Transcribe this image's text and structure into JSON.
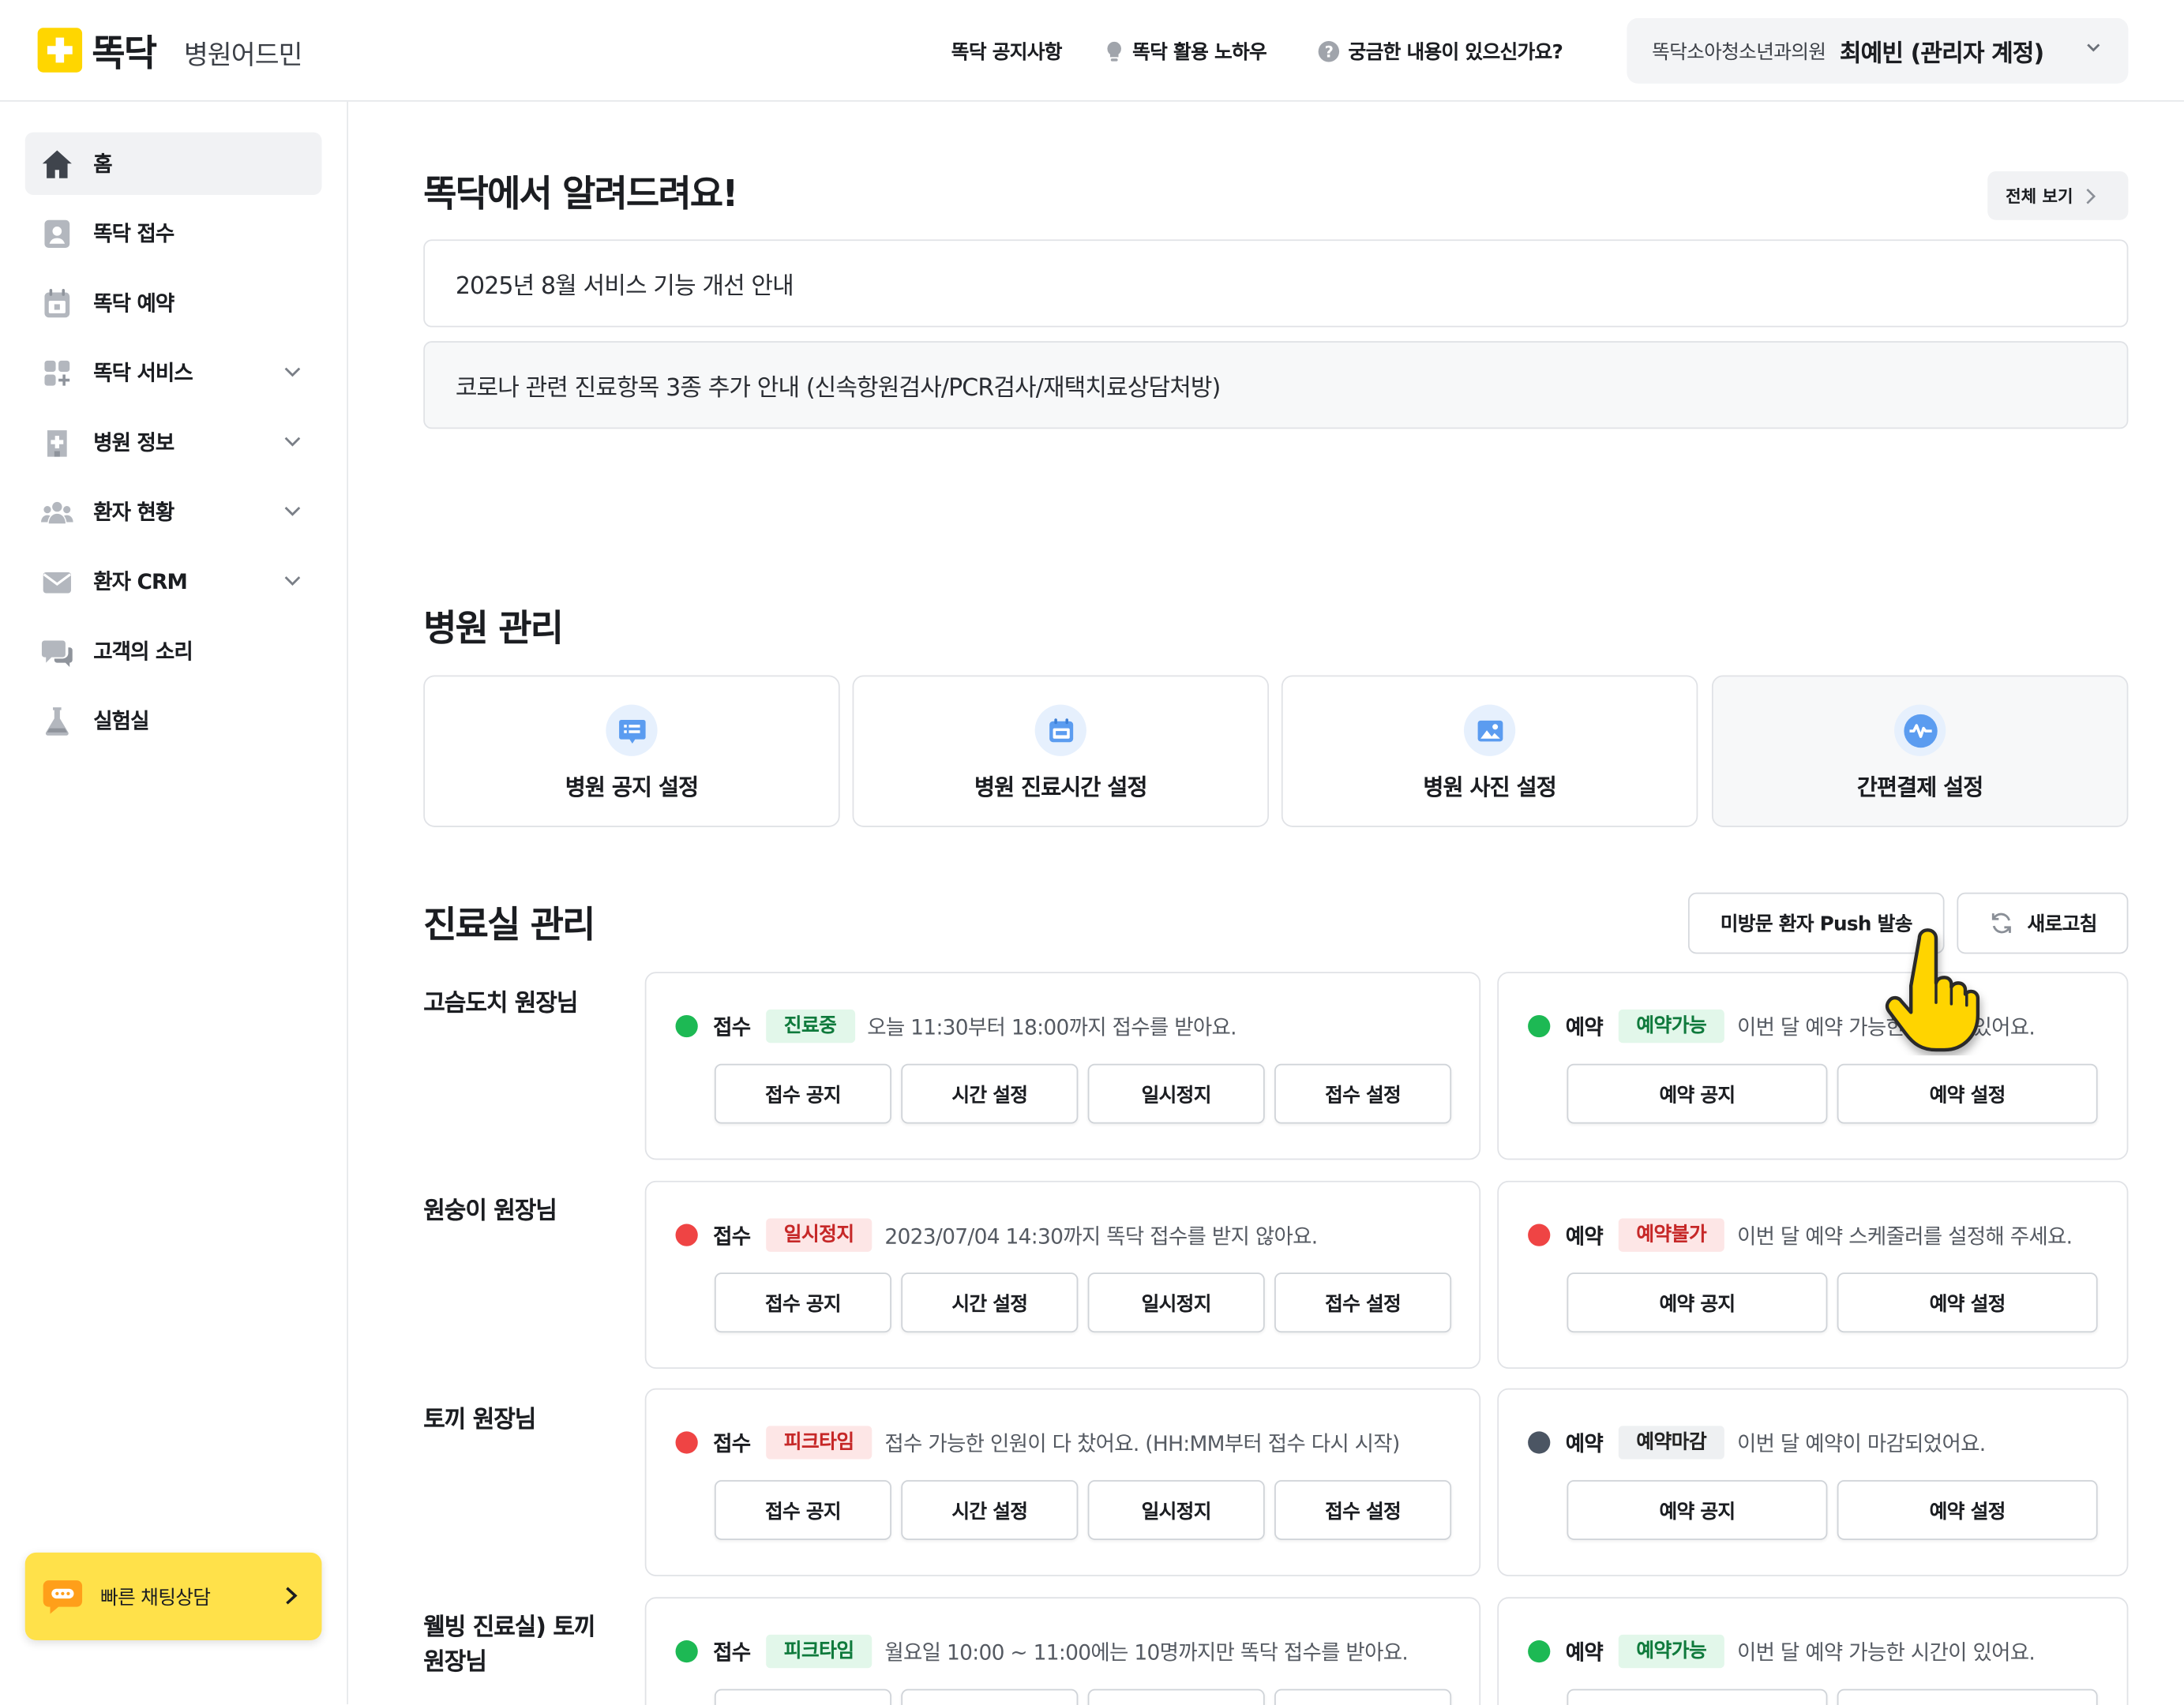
{
  "header": {
    "brand": "똑닥",
    "brand_sub": "병원어드민",
    "nav": [
      "똑닥 공지사항",
      "똑닥 활용 노하우",
      "궁금한 내용이 있으신가요?"
    ],
    "hospital": "똑닥소아청소년과의원",
    "user": "최예빈 (관리자 계정)"
  },
  "sidebar": {
    "items": [
      {
        "label": "홈",
        "icon": "home-icon",
        "active": true
      },
      {
        "label": "똑닥 접수",
        "icon": "reception-icon"
      },
      {
        "label": "똑닥 예약",
        "icon": "calendar-icon"
      },
      {
        "label": "똑닥 서비스",
        "icon": "grid-plus-icon",
        "expandable": true
      },
      {
        "label": "병원 정보",
        "icon": "hospital-icon",
        "expandable": true
      },
      {
        "label": "환자 현황",
        "icon": "people-icon",
        "expandable": true
      },
      {
        "label": "환자 CRM",
        "icon": "mail-icon",
        "expandable": true
      },
      {
        "label": "고객의 소리",
        "icon": "chat-bubbles-icon"
      },
      {
        "label": "실험실",
        "icon": "flask-icon"
      }
    ],
    "chat": "빠른 채팅상담"
  },
  "notices": {
    "title": "똑닥에서 알려드려요!",
    "view_all": "전체 보기",
    "items": [
      "2025년 8월 서비스 기능 개선 안내",
      "코로나 관련 진료항목 3종 추가 안내 (신속항원검사/PCR검사/재택치료상담처방)"
    ]
  },
  "management": {
    "title": "병원 관리",
    "cards": [
      "병원 공지 설정",
      "병원 진료시간 설정",
      "병원 사진 설정",
      "간편결제 설정"
    ]
  },
  "clinic": {
    "title": "진료실 관리",
    "push_button": "미방문 환자 Push 발송",
    "refresh_button": "새로고침",
    "reception_type": "접수",
    "reservation_type": "예약",
    "reception_buttons": [
      "접수 공지",
      "시간 설정",
      "일시정지",
      "접수 설정"
    ],
    "reservation_buttons": [
      "예약 공지",
      "예약 설정"
    ],
    "doctors": [
      {
        "name": "고슴도치 원장님",
        "reception": {
          "badge": "진료중",
          "color": "green",
          "text": "오늘 11:30부터 18:00까지 접수를 받아요."
        },
        "reservation": {
          "badge": "예약가능",
          "color": "green",
          "text": "이번 달 예약 가능한 시간이 있어요."
        }
      },
      {
        "name": "원숭이 원장님",
        "reception": {
          "badge": "일시정지",
          "color": "red",
          "text": "2023/07/04 14:30까지 똑닥 접수를 받지 않아요."
        },
        "reservation": {
          "badge": "예약불가",
          "color": "red",
          "text": "이번 달 예약 스케줄러를 설정해 주세요."
        }
      },
      {
        "name": "토끼 원장님",
        "reception": {
          "badge": "피크타임",
          "color": "red",
          "text": "접수 가능한 인원이 다 찼어요. (HH:MM부터 접수 다시 시작)"
        },
        "reservation": {
          "badge": "예약마감",
          "color": "gray",
          "text": "이번 달 예약이 마감되었어요."
        }
      },
      {
        "name": "웰빙 진료실) 토끼 원장님",
        "reception": {
          "badge": "피크타임",
          "color": "green",
          "text": "월요일 10:00 ~ 11:00에는 10명까지만 똑닥 접수를 받아요."
        },
        "reservation": {
          "badge": "예약가능",
          "color": "green",
          "text": "이번 달 예약 가능한 시간이 있어요."
        }
      }
    ]
  },
  "colors": {
    "brand_yellow": "#ffd600",
    "status_green": "#1db954",
    "status_red": "#ef4444",
    "status_gray": "#4b5563",
    "icon_blue": "#5b9cf0"
  }
}
